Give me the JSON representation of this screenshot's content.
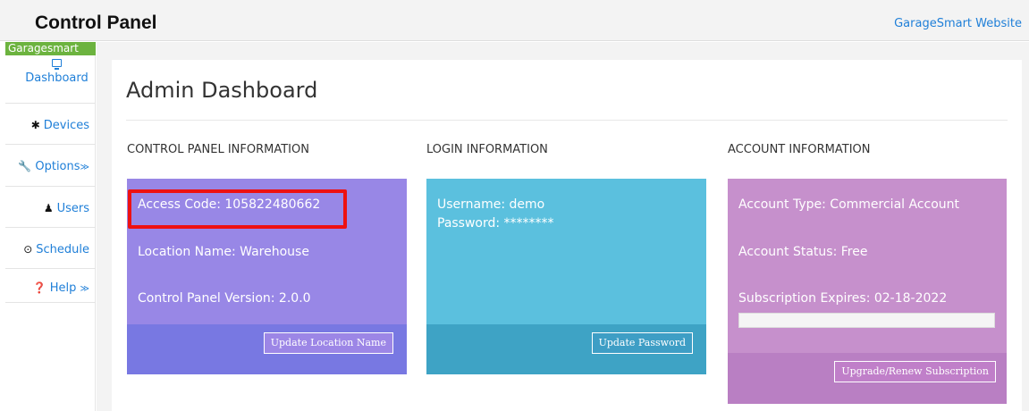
{
  "header": {
    "title": "Control Panel",
    "website_link": "GarageSmart Website"
  },
  "sidebar": {
    "brand": "Garagesmart",
    "items": [
      {
        "label": "Dashboard",
        "icon": "monitor-icon"
      },
      {
        "label": "Devices",
        "icon": "gear-icon",
        "glyph": "✱"
      },
      {
        "label": "Options",
        "icon": "wrench-icon",
        "glyph": "🔧",
        "chevron": "≫"
      },
      {
        "label": "Users",
        "icon": "user-icon",
        "glyph": "♟"
      },
      {
        "label": "Schedule",
        "icon": "clock-icon",
        "glyph": "⊙"
      },
      {
        "label": "Help",
        "icon": "question-circle-icon",
        "glyph": "❓",
        "chevron": "≫"
      }
    ]
  },
  "main": {
    "page_title": "Admin Dashboard",
    "sections": [
      {
        "heading": "CONTROL PANEL INFORMATION",
        "lines": [
          "Access Code: 105822480662",
          "Location Name: Warehouse",
          "Control Panel Version: 2.0.0"
        ],
        "button": "Update Location Name"
      },
      {
        "heading": "LOGIN INFORMATION",
        "lines": [
          "Username: demo",
          "Password: ********"
        ],
        "button": "Update Password"
      },
      {
        "heading": "ACCOUNT INFORMATION",
        "lines": [
          "Account Type: Commercial Account",
          "Account Status: Free",
          "Subscription Expires: 02-18-2022"
        ],
        "progress": 0,
        "button": "Upgrade/Renew Subscription"
      }
    ]
  },
  "colors": {
    "accent_link": "#1f7fd8",
    "brand_green": "#6cb33f",
    "card_purple": "#9887e6",
    "card_cyan": "#5bc0de",
    "card_pink": "#c690cc",
    "highlight_red": "#ee1111"
  }
}
